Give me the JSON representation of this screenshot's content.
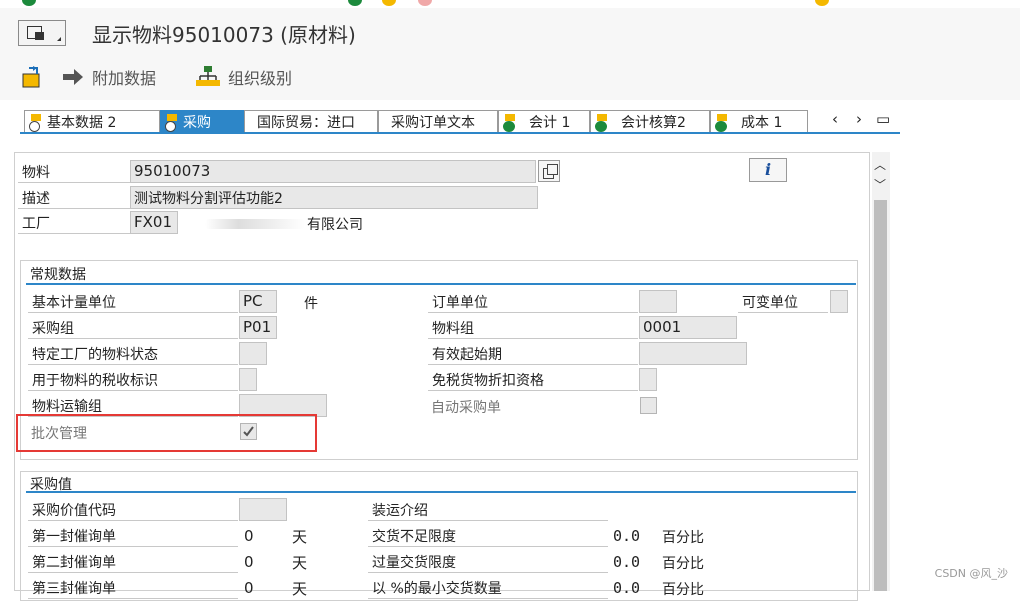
{
  "title": "显示物料95010073 (原材料)",
  "toolbar": {
    "extra_data": "附加数据",
    "org_levels": "组织级别"
  },
  "tabs": [
    "基本数据 2",
    "采购",
    "国际贸易：进口",
    "采购订单文本",
    "会计 1",
    "会计核算2",
    "成本 1"
  ],
  "header_fields": {
    "material_label": "物料",
    "material_value": "95010073",
    "desc_label": "描述",
    "desc_value": "测试物料分割评估功能2",
    "plant_label": "工厂",
    "plant_value": "FX01",
    "plant_name": "有限公司"
  },
  "info_button": "i",
  "general": {
    "title": "常规数据",
    "base_uom_label": "基本计量单位",
    "base_uom_value": "PC",
    "base_uom_text": "件",
    "order_unit_label": "订单单位",
    "var_unit_label": "可变单位",
    "purch_group_label": "采购组",
    "purch_group_value": "P01",
    "mat_group_label": "物料组",
    "mat_group_value": "0001",
    "plant_status_label": "特定工厂的物料状态",
    "valid_from_label": "有效起始期",
    "tax_ind_label": "用于物料的税收标识",
    "tax_disc_label": "免税货物折扣资格",
    "transport_label": "物料运输组",
    "auto_po_label": "自动采购单",
    "batch_label": "批次管理"
  },
  "purchasing": {
    "title": "采购值",
    "value_key_label": "采购价值代码",
    "ship_instr_label": "装运介绍",
    "rem1_label": "第一封催询单",
    "rem1_value": "0",
    "rem1_unit": "天",
    "rem2_label": "第二封催询单",
    "rem2_value": "0",
    "rem2_unit": "天",
    "rem3_label": "第三封催询单",
    "rem3_value": "0",
    "rem3_unit": "天",
    "under_label": "交货不足限度",
    "under_value": "0.0",
    "under_unit": "百分比",
    "over_label": "过量交货限度",
    "over_value": "0.0",
    "over_unit": "百分比",
    "min_label": "以 %的最小交货数量",
    "min_value": "0.0",
    "min_unit": "百分比"
  },
  "watermark": "CSDN @风_沙"
}
